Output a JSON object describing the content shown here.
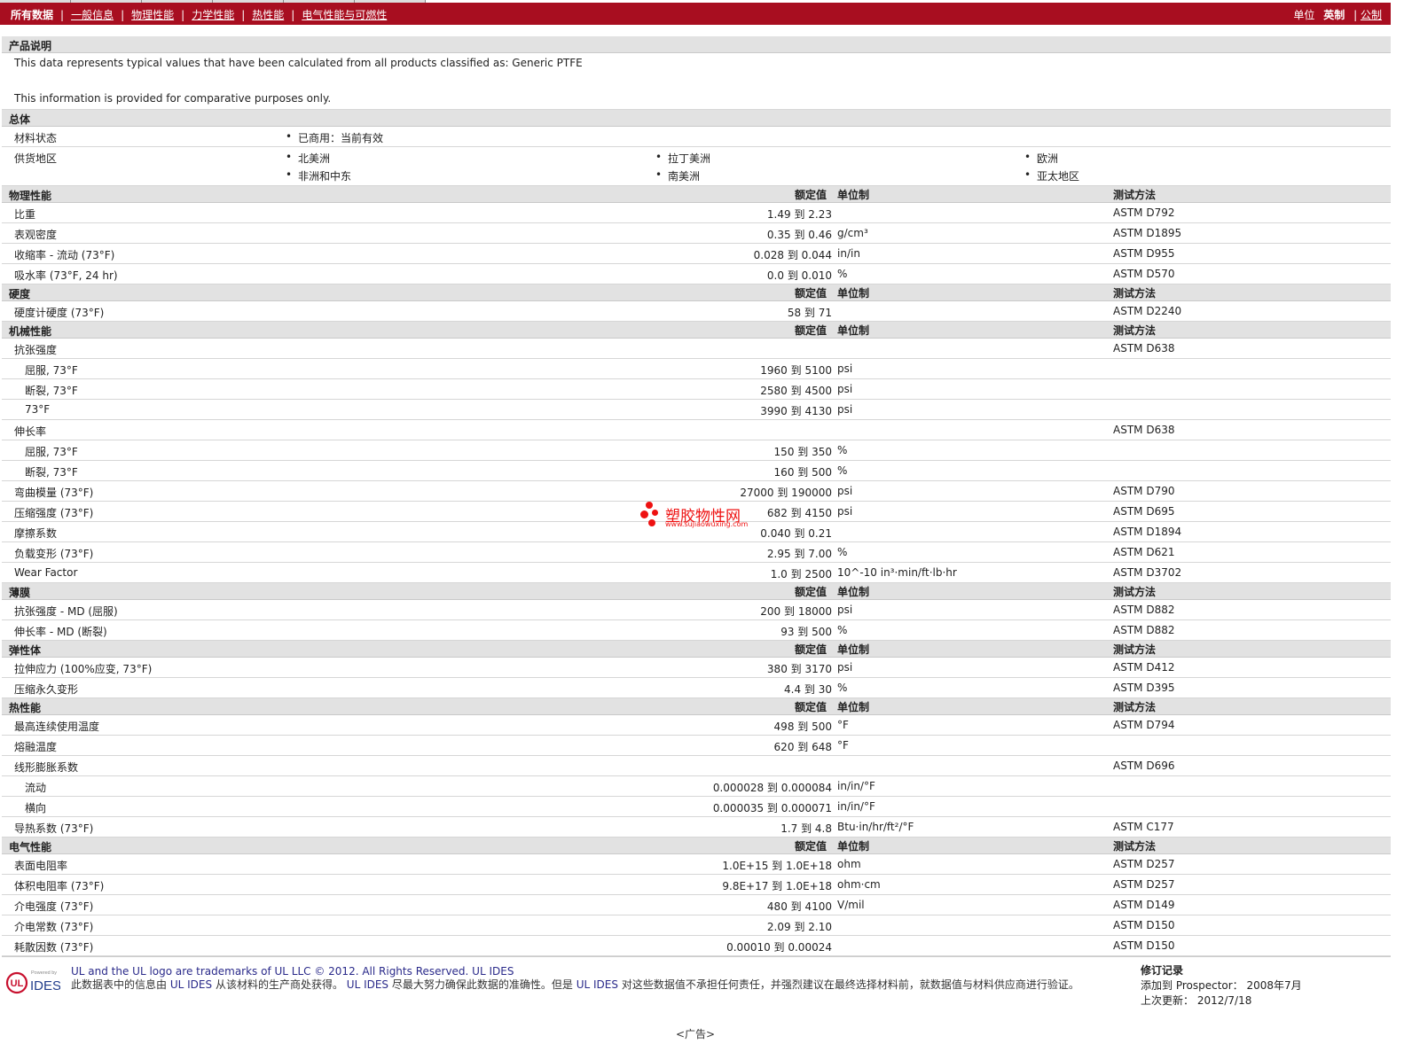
{
  "nav": {
    "current": "所有数据",
    "links": [
      "一般信息",
      "物理性能",
      "力学性能",
      "热性能",
      "电气性能与可燃性"
    ],
    "sep": "|"
  },
  "units": {
    "label": "单位",
    "active": "英制",
    "sep": "|",
    "other": "公制"
  },
  "headers": {
    "value": "额定值",
    "unit": "单位制",
    "method": "测试方法"
  },
  "description": {
    "title": "产品说明",
    "line1": "This data represents typical values that have been calculated from all products classified as: Generic PTFE",
    "line2": "This information is provided for comparative purposes only."
  },
  "general": {
    "title": "总体",
    "status_label": "材料状态",
    "status_value": "已商用：当前有效",
    "regions_label": "供货地区",
    "regions": [
      "北美洲",
      "拉丁美洲",
      "欧洲",
      "非洲和中东",
      "南美洲",
      "亚太地区"
    ]
  },
  "sections": [
    {
      "title": "物理性能",
      "rows": [
        {
          "p": "比重",
          "v": "1.49 到  2.23",
          "u": "",
          "m": "ASTM D792"
        },
        {
          "p": "表观密度",
          "v": "0.35 到  0.46",
          "u": "g/cm³",
          "m": "ASTM D1895"
        },
        {
          "p": "收缩率 - 流动 (73°F)",
          "v": "0.028 到  0.044",
          "u": "in/in",
          "m": "ASTM D955"
        },
        {
          "p": "吸水率 (73°F, 24 hr)",
          "v": "0.0 到  0.010",
          "u": "%",
          "m": "ASTM D570"
        }
      ]
    },
    {
      "title": "硬度",
      "rows": [
        {
          "p": "硬度计硬度 (73°F)",
          "v": "58 到  71",
          "u": "",
          "m": "ASTM D2240"
        }
      ]
    },
    {
      "title": "机械性能",
      "rows": [
        {
          "p": "抗张强度",
          "v": "",
          "u": "",
          "m": "ASTM D638"
        },
        {
          "p": "屈服, 73°F",
          "v": "1960 到  5100",
          "u": "psi",
          "m": "",
          "sub": true
        },
        {
          "p": "断裂, 73°F",
          "v": "2580 到  4500",
          "u": "psi",
          "m": "",
          "sub": true
        },
        {
          "p": "73°F",
          "v": "3990 到  4130",
          "u": "psi",
          "m": "",
          "sub": true
        },
        {
          "p": "伸长率",
          "v": "",
          "u": "",
          "m": "ASTM D638"
        },
        {
          "p": "屈服, 73°F",
          "v": "150 到  350",
          "u": "%",
          "m": "",
          "sub": true
        },
        {
          "p": "断裂, 73°F",
          "v": "160 到  500",
          "u": "%",
          "m": "",
          "sub": true
        },
        {
          "p": "弯曲模量 (73°F)",
          "v": "27000 到  190000",
          "u": "psi",
          "m": "ASTM D790"
        },
        {
          "p": "压缩强度 (73°F)",
          "v": "682 到  4150",
          "u": "psi",
          "m": "ASTM D695"
        },
        {
          "p": "摩擦系数",
          "v": "0.040 到  0.21",
          "u": "",
          "m": "ASTM D1894"
        },
        {
          "p": "负载变形 (73°F)",
          "v": "2.95 到  7.00",
          "u": "%",
          "m": "ASTM D621"
        },
        {
          "p": "Wear Factor",
          "v": "1.0 到  2500",
          "u": "10^-10 in³·min/ft·lb·hr",
          "m": "ASTM D3702"
        }
      ]
    },
    {
      "title": "薄膜",
      "rows": [
        {
          "p": "抗张强度 - MD (屈服)",
          "v": "200 到  18000",
          "u": "psi",
          "m": "ASTM D882"
        },
        {
          "p": "伸长率 - MD (断裂)",
          "v": "93 到  500",
          "u": "%",
          "m": "ASTM D882"
        }
      ]
    },
    {
      "title": "弹性体",
      "rows": [
        {
          "p": "拉伸应力 (100%应变, 73°F)",
          "v": "380 到  3170",
          "u": "psi",
          "m": "ASTM D412"
        },
        {
          "p": "压缩永久变形",
          "v": "4.4 到  30",
          "u": "%",
          "m": "ASTM D395"
        }
      ]
    },
    {
      "title": "热性能",
      "rows": [
        {
          "p": "最高连续使用温度",
          "v": "498 到  500",
          "u": "°F",
          "m": "ASTM D794"
        },
        {
          "p": "熔融温度",
          "v": "620 到  648",
          "u": "°F",
          "m": ""
        },
        {
          "p": "线形膨胀系数",
          "v": "",
          "u": "",
          "m": "ASTM D696"
        },
        {
          "p": "流动",
          "v": "0.000028 到  0.000084",
          "u": "in/in/°F",
          "m": "",
          "sub": true
        },
        {
          "p": "横向",
          "v": "0.000035 到  0.000071",
          "u": "in/in/°F",
          "m": "",
          "sub": true
        },
        {
          "p": "导热系数 (73°F)",
          "v": "1.7 到  4.8",
          "u": "Btu·in/hr/ft²/°F",
          "m": "ASTM C177"
        }
      ]
    },
    {
      "title": "电气性能",
      "rows": [
        {
          "p": "表面电阻率",
          "v": "1.0E+15 到  1.0E+18",
          "u": "ohm",
          "m": "ASTM D257"
        },
        {
          "p": "体积电阻率 (73°F)",
          "v": "9.8E+17 到  1.0E+18",
          "u": "ohm·cm",
          "m": "ASTM D257"
        },
        {
          "p": "介电强度 (73°F)",
          "v": "480 到  4100",
          "u": "V/mil",
          "m": "ASTM D149"
        },
        {
          "p": "介电常数 (73°F)",
          "v": "2.09 到  2.10",
          "u": "",
          "m": "ASTM D150"
        },
        {
          "p": "耗散因数 (73°F)",
          "v": "0.00010 到  0.00024",
          "u": "",
          "m": "ASTM D150"
        }
      ]
    }
  ],
  "footer": {
    "logo_powered": "Powered by",
    "logo_text": "IDES",
    "trademark": "UL and the UL logo are trademarks of UL LLC © 2012. All Rights Reserved. UL IDES",
    "disclaimer_a": "此数据表中的信息由",
    "brand": "UL IDES",
    "disclaimer_b": "从该材料的生产商处获得。",
    "disclaimer_c": "尽最大努力确保此数据的准确性。但是",
    "disclaimer_d": "对这些数据值不承担任何责任，并强烈建议在最终选择材料前，就数据值与材料供应商进行验证。",
    "rev_title": "修订记录",
    "rev_added": "添加到 Prospector： 2008年7月",
    "rev_updated": "上次更新： 2012/7/18"
  },
  "watermark": {
    "big": "塑胶物性网",
    "small": "www.sujiaowuxing.com"
  },
  "ad": "<广告>"
}
